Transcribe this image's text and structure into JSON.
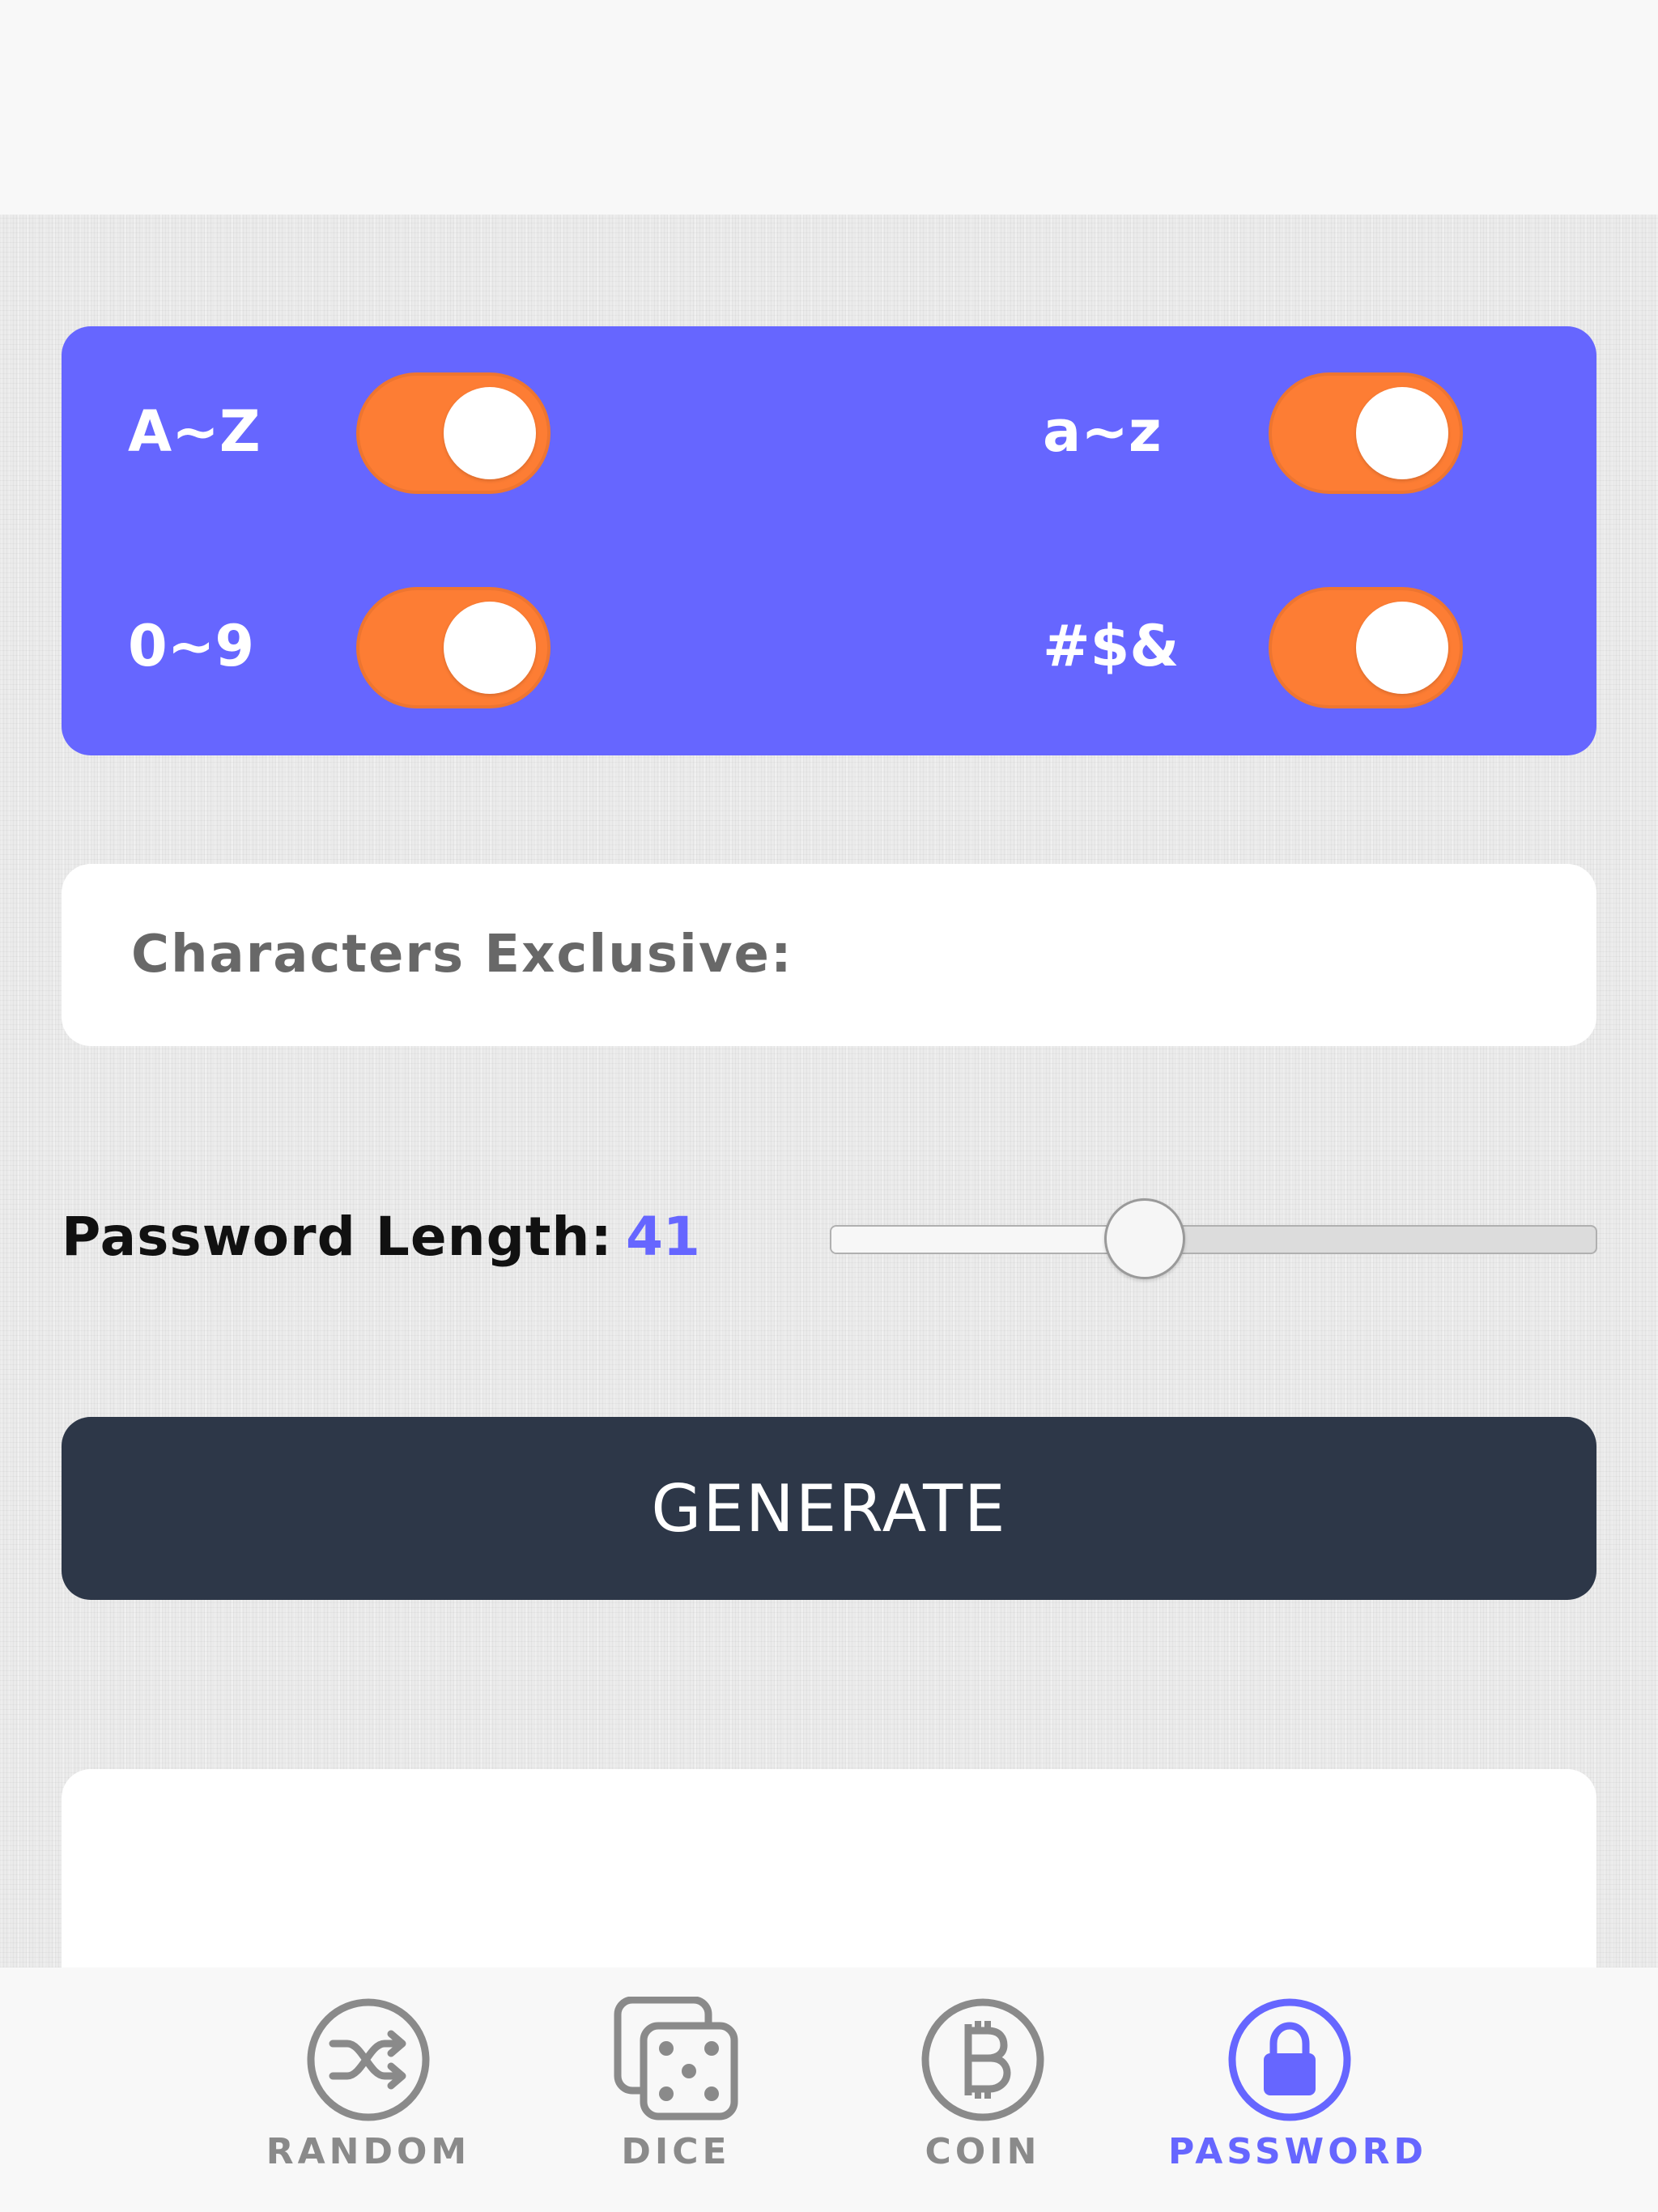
{
  "colors": {
    "accent": "#6666ff",
    "toggle_on": "#fd7d34",
    "button_dark": "#2d3748",
    "tab_inactive": "#8a8a8a"
  },
  "options": {
    "uppercase": {
      "label": "A~Z",
      "enabled": true
    },
    "lowercase": {
      "label": "a~z",
      "enabled": true
    },
    "digits": {
      "label": "0~9",
      "enabled": true
    },
    "symbols": {
      "label": "#$&",
      "enabled": true
    }
  },
  "exclusive": {
    "label": "Characters Exclusive:",
    "value": ""
  },
  "length": {
    "label": "Password Length:",
    "value": "41",
    "slider_fraction": 0.41
  },
  "generate_label": "GENERATE",
  "result": "",
  "tabs": [
    {
      "label": "RANDOM",
      "icon": "shuffle-icon",
      "active": false
    },
    {
      "label": "DICE",
      "icon": "dice-icon",
      "active": false
    },
    {
      "label": "COIN",
      "icon": "bitcoin-icon",
      "active": false
    },
    {
      "label": "PASSWORD",
      "icon": "lock-icon",
      "active": true
    }
  ]
}
